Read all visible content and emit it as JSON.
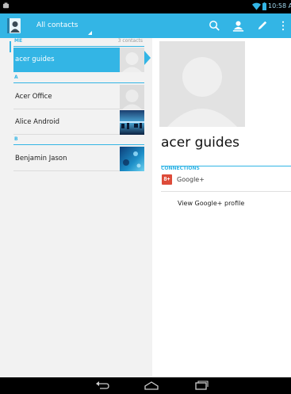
{
  "status_bar": {
    "time": "10:58 A",
    "icons": [
      "notification-icon",
      "wifi-icon",
      "battery-icon"
    ]
  },
  "action_bar": {
    "filter_label": "All contacts",
    "icons": [
      "contacts-app-icon",
      "search-icon",
      "add-contact-icon",
      "edit-icon",
      "overflow-menu-icon"
    ],
    "background_color": "#33b5e5"
  },
  "contact_list": {
    "sections": [
      {
        "letter": "ME",
        "count": "3 contacts",
        "contacts": [
          {
            "name": "acer guides",
            "selected": true,
            "thumbnail": "default-avatar"
          }
        ]
      },
      {
        "letter": "A",
        "contacts": [
          {
            "name": "Acer Office",
            "thumbnail": "default-avatar"
          },
          {
            "name": "Alice Android",
            "thumbnail": "photo-skyline"
          }
        ]
      },
      {
        "letter": "B",
        "contacts": [
          {
            "name": "Benjamin Jason",
            "thumbnail": "photo-underwater"
          }
        ]
      }
    ]
  },
  "detail": {
    "name": "acer guides",
    "connections_header": "CONNECTIONS",
    "google_plus_label": "Google+",
    "google_plus_icon_text": "8+",
    "view_profile_label": "View Google+ profile",
    "accent_color": "#33b5e5"
  },
  "nav_bar": {
    "icons": [
      "back-icon",
      "home-icon",
      "recent-apps-icon"
    ]
  }
}
